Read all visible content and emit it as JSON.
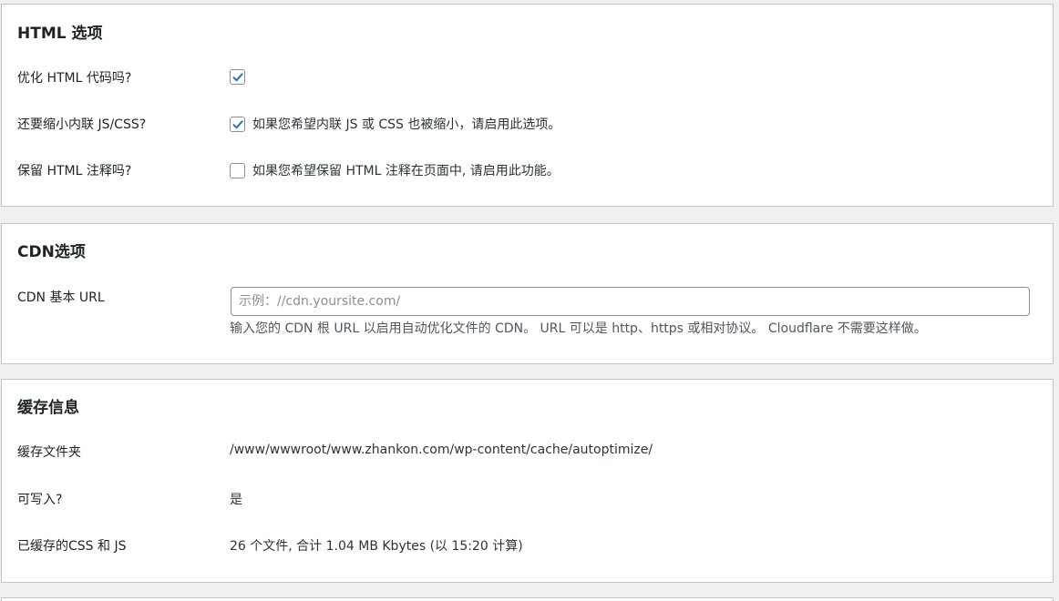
{
  "html_options": {
    "title": "HTML 选项",
    "rows": [
      {
        "label": "优化 HTML 代码吗?",
        "checked": true,
        "desc": ""
      },
      {
        "label": "还要缩小内联 JS/CSS?",
        "checked": true,
        "desc": "如果您希望内联 JS 或 CSS 也被缩小，请启用此选项。"
      },
      {
        "label": "保留 HTML 注释吗?",
        "checked": false,
        "desc": "如果您希望保留 HTML 注释在页面中, 请启用此功能。"
      }
    ]
  },
  "cdn_options": {
    "title": "CDN选项",
    "label": "CDN 基本 URL",
    "value": "",
    "placeholder": "示例：//cdn.yoursite.com/",
    "help": "输入您的 CDN 根 URL 以启用自动优化文件的 CDN。 URL 可以是 http、https 或相对协议。 Cloudflare 不需要这样做。"
  },
  "cache_info": {
    "title": "缓存信息",
    "rows": [
      {
        "label": "缓存文件夹",
        "value": "/www/wwwroot/www.zhankon.com/wp-content/cache/autoptimize/"
      },
      {
        "label": "可写入?",
        "value": "是"
      },
      {
        "label": "已缓存的CSS 和 JS",
        "value": "26 个文件, 合计 1.04 MB Kbytes (以 15:20 计算)"
      }
    ]
  },
  "colors": {
    "checkmark": "#2271b1",
    "page_bg": "#f0f0f1",
    "card_border": "#c3c4c7"
  }
}
